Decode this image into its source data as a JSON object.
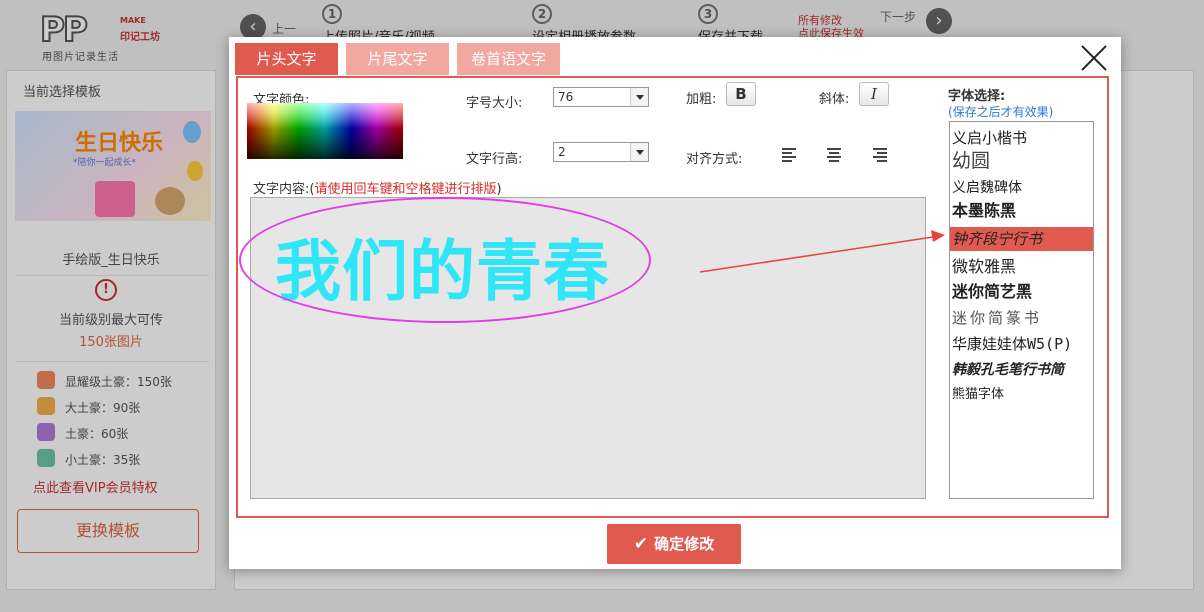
{
  "logo": {
    "pp": "PP",
    "make": "MAKE",
    "brand": "印记工坊",
    "slogan": "用图片记录生活"
  },
  "steps": {
    "prev": "上一步",
    "next": "下一步",
    "items": [
      {
        "num": "1",
        "label": "上传照片/音乐/视频"
      },
      {
        "num": "2",
        "label": "设定相册播放参数"
      },
      {
        "num": "3",
        "label": "保存并下载"
      }
    ],
    "save_note_1": "所有修改",
    "save_note_2": "点此保存生效"
  },
  "left_panel": {
    "title": "当前选择模板",
    "template_art_title": "生日快乐",
    "template_art_sub": "*陪你一起成长*",
    "template_name": "手绘版_生日快乐",
    "max_label": "当前级别最大可传",
    "max_count": "150张图片",
    "tiers": [
      {
        "label": "显耀级土豪：150张",
        "color": "#f08a5d"
      },
      {
        "label": "大土豪：90张",
        "color": "#f4b04b"
      },
      {
        "label": "土豪：60张",
        "color": "#b07be0"
      },
      {
        "label": "小土豪：35张",
        "color": "#6ec6a8"
      }
    ],
    "vip_link": "点此查看VIP会员特权",
    "change_button": "更换模板"
  },
  "modal": {
    "tabs": [
      "片头文字",
      "片尾文字",
      "卷首语文字"
    ],
    "active_tab": 0,
    "color_label": "文字颜色:",
    "size_label": "字号大小:",
    "size_value": "76",
    "line_height_label": "文字行高:",
    "line_height_value": "2",
    "bold_label": "加粗:",
    "bold_glyph": "B",
    "italic_label": "斜体:",
    "italic_glyph": "I",
    "align_label": "对齐方式:",
    "content_label_prefix": "文字内容:(",
    "content_label_hint": "请使用回车键和空格键进行排版",
    "content_label_suffix": ")",
    "content_text": "我们的青春",
    "font_title": "字体选择:",
    "font_note": "(保存之后才有效果)",
    "fonts": [
      "义启小楷书",
      "幼圆",
      "义启魏碑体",
      "本墨陈黑",
      "钟齐段宁行书",
      "微软雅黑",
      "迷你简艺黑",
      "迷你简篆书",
      "华康娃娃体W5(P)",
      "韩毅孔毛笔行书简",
      "熊猫字体"
    ],
    "selected_font_index": 4,
    "confirm_button": "确定修改",
    "confirm_icon": "✔"
  },
  "colors": {
    "accent": "#e05a4f",
    "tab_inactive": "#f2a79f",
    "content_text": "#2ee6f7",
    "annotation_ellipse": "#e13ce8",
    "annotation_arrow": "#e8433a",
    "link_blue": "#2a7ad4"
  }
}
